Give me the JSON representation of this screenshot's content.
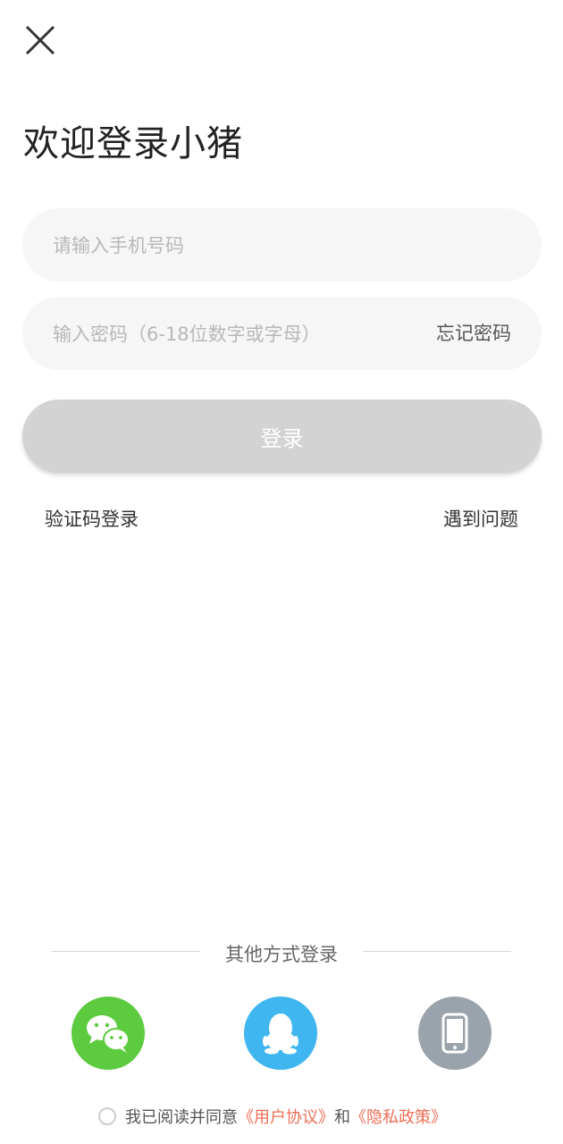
{
  "header": {
    "title": "欢迎登录小猪"
  },
  "form": {
    "phone_placeholder": "请输入手机号码",
    "password_placeholder": "输入密码（6-18位数字或字母）",
    "forgot_label": "忘记密码",
    "login_label": "登录"
  },
  "links": {
    "sms_login": "验证码登录",
    "help": "遇到问题"
  },
  "other": {
    "label": "其他方式登录",
    "methods": [
      {
        "icon": "wechat-icon",
        "color": "#5ccb3f"
      },
      {
        "icon": "qq-icon",
        "color": "#3fb6ef"
      },
      {
        "icon": "phone-icon",
        "color": "#9aa3ab"
      }
    ]
  },
  "agreement": {
    "prefix": "我已阅读并同意",
    "user_agreement": "《用户协议》",
    "and": "和",
    "privacy_policy": "《隐私政策》"
  },
  "colors": {
    "accent_link": "#ef6d55",
    "button_disabled": "#d3d3d3"
  }
}
